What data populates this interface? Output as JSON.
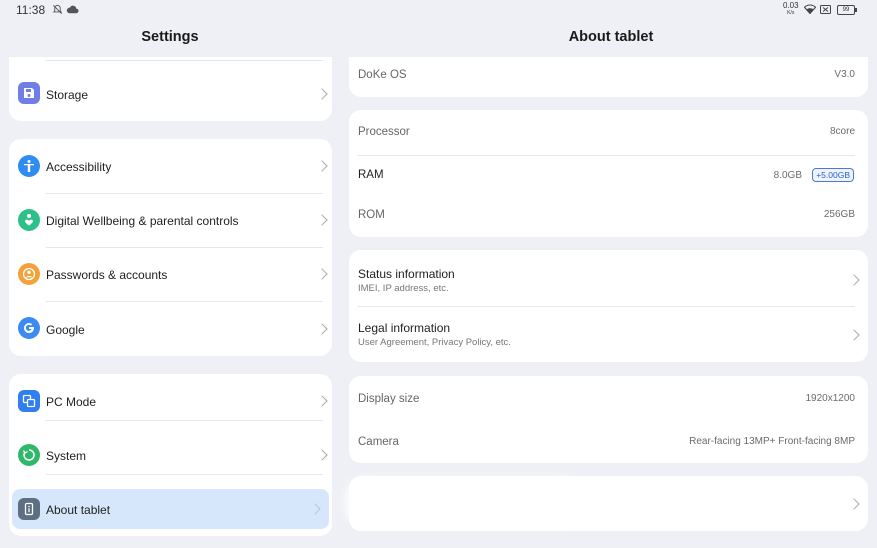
{
  "status_bar": {
    "time": "11:38",
    "net_speed": "0.03",
    "net_unit": "K/s",
    "battery": "99"
  },
  "left": {
    "title": "Settings",
    "groups": [
      {
        "items": [
          {
            "label": "Storage",
            "icon": "storage-icon",
            "color": "#6f7fe6"
          }
        ]
      },
      {
        "items": [
          {
            "label": "Accessibility",
            "icon": "accessibility-icon",
            "color": "#2f8cf0"
          },
          {
            "label": "Digital Wellbeing & parental controls",
            "icon": "wellbeing-icon",
            "color": "#2fbf88"
          },
          {
            "label": "Passwords & accounts",
            "icon": "passwords-icon",
            "color": "#f2a23a"
          },
          {
            "label": "Google",
            "icon": "google-icon",
            "color": "#3d8af2"
          }
        ]
      },
      {
        "items": [
          {
            "label": "PC Mode",
            "icon": "pc-mode-icon",
            "color": "#2f7ff0"
          },
          {
            "label": "System",
            "icon": "system-icon",
            "color": "#2fb86a"
          },
          {
            "label": "About tablet",
            "icon": "about-tablet-icon",
            "color": "#5d6f80",
            "selected": true
          }
        ]
      }
    ]
  },
  "right": {
    "title": "About tablet",
    "os": {
      "label": "DoKe OS",
      "value": "V3.0"
    },
    "hardware": {
      "processor": {
        "label": "Processor",
        "value": "8core"
      },
      "ram": {
        "label": "RAM",
        "value": "8.0GB",
        "badge": "+5.00GB"
      },
      "rom": {
        "label": "ROM",
        "value": "256GB"
      }
    },
    "info": {
      "status": {
        "title": "Status information",
        "subtitle": "IMEI, IP address, etc."
      },
      "legal": {
        "title": "Legal information",
        "subtitle": "User Agreement, Privacy Policy, etc."
      }
    },
    "display": {
      "size": {
        "label": "Display size",
        "value": "1920x1200"
      },
      "camera": {
        "label": "Camera",
        "value": "Rear-facing 13MP+ Front-facing 8MP"
      }
    }
  },
  "colors": {
    "selected_bg": "#d6e7fb",
    "background": "#eef0f5",
    "card": "#ffffff",
    "badge_blue": "#2a5fc9"
  }
}
